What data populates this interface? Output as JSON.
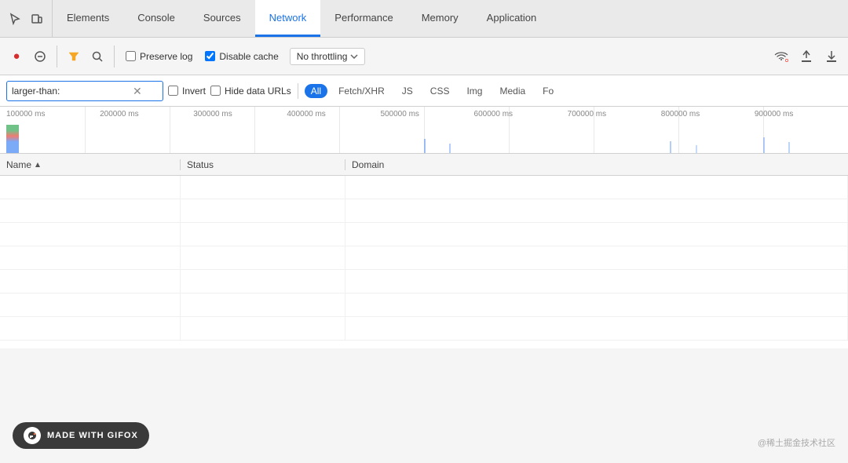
{
  "tabs": {
    "items": [
      {
        "label": "Elements",
        "active": false
      },
      {
        "label": "Console",
        "active": false
      },
      {
        "label": "Sources",
        "active": false
      },
      {
        "label": "Network",
        "active": true
      },
      {
        "label": "Performance",
        "active": false
      },
      {
        "label": "Memory",
        "active": false
      },
      {
        "label": "Application",
        "active": false
      }
    ]
  },
  "toolbar": {
    "preserve_log_label": "Preserve log",
    "disable_cache_label": "Disable cache",
    "throttle_label": "No throttling",
    "preserve_log_checked": false,
    "disable_cache_checked": true
  },
  "filter": {
    "search_value": "larger-than:",
    "search_placeholder": "",
    "invert_label": "Invert",
    "hide_data_urls_label": "Hide data URLs",
    "type_buttons": [
      {
        "label": "All",
        "active": true
      },
      {
        "label": "Fetch/XHR",
        "active": false
      },
      {
        "label": "JS",
        "active": false
      },
      {
        "label": "CSS",
        "active": false
      },
      {
        "label": "Img",
        "active": false
      },
      {
        "label": "Media",
        "active": false
      },
      {
        "label": "Fo",
        "active": false
      }
    ]
  },
  "timeline": {
    "labels": [
      "100000 ms",
      "200000 ms",
      "300000 ms",
      "400000 ms",
      "500000 ms",
      "600000 ms",
      "700000 ms",
      "800000 ms",
      "900000 ms"
    ]
  },
  "table": {
    "columns": [
      {
        "label": "Name",
        "sort": true
      },
      {
        "label": "Status",
        "sort": false
      },
      {
        "label": "Domain",
        "sort": false
      }
    ]
  },
  "watermark": "@稀土掘金技术社区",
  "gifox": {
    "label": "MADE WITH GIFOX"
  }
}
